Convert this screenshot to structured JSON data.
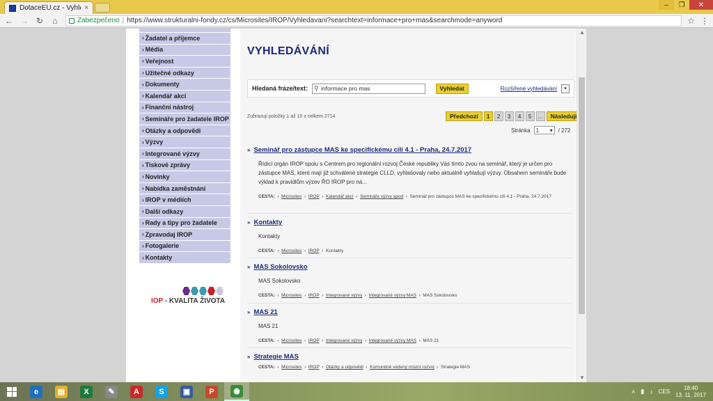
{
  "browser": {
    "tab_title": "DotaceEU.cz - Vyhledáv",
    "tab_close": "×",
    "secure_label": "Zabezpečeno",
    "url": "https://www.strukturalni-fondy.cz/cs/Microsites/IROP/Vyhledavani?searchtext=informace+pro+mas&searchmode=anyword",
    "icons": [
      "favicon-icon",
      "back-icon",
      "forward-icon",
      "reload-icon",
      "home-icon",
      "lock-icon",
      "star-icon",
      "menu-icon"
    ]
  },
  "sidebar": {
    "items": [
      "Žadatel a příjemce",
      "Média",
      "Veřejnost",
      "Užitečné odkazy",
      "Dokumenty",
      "Kalendář akcí",
      "Finanční nástroj",
      "Semináře pro žadatele IROP",
      "Otázky a odpovědi",
      "Výzvy",
      "Integrované výzvy",
      "Tiskové zprávy",
      "Novinky",
      "Nabídka zaměstnání",
      "IROP v médiích",
      "Další odkazy",
      "Rady a tipy pro žadatele",
      "Zpravodaj IROP",
      "Fotogalerie",
      "Kontakty"
    ],
    "logo": {
      "prefix": "IOP",
      "suffix": " - KVALITA ŽIVOTA",
      "hex_colors": [
        "#6a2a8c",
        "#3a9ab0",
        "#3a9ab0",
        "#c8202a",
        "#c8c8d8"
      ]
    }
  },
  "main": {
    "title": "VYHLEDÁVÁNÍ",
    "search": {
      "label": "Hledaná fráze/text:",
      "value": "informace pro mas",
      "button": "Vyhledat",
      "advanced": "Rozšířené vyhledávání"
    },
    "results_info": "Zobrazuji položky 1 až 10 z celkem 2714",
    "pager": {
      "prev": "Předchozí",
      "pages": [
        "1",
        "2",
        "3",
        "4",
        "5",
        "..."
      ],
      "next": "Následující",
      "page_label": "Stránka",
      "page_value": "1",
      "total": "/ 272"
    },
    "path_label": "CESTA:",
    "results": [
      {
        "title": "Seminář pro zástupce MAS ke specifickému cíli 4.1 - Praha, 24.7.2017",
        "desc": "Řídicí orgán IROP spolu s Centrem pro regionální rozvoj České republiky Vás tímto zvou na seminář, který je určen pro zástupce MAS, které mají již schválené strategie CLLD, vyhlašovaly nebo aktuálně vyhlašují výzvy. Obsahem semináře bude výklad k pravidlům výzev ŘO IROP pro ná...",
        "path": [
          "Microsites",
          "IROP",
          "Kalendář akcí",
          "Semináře výzvy apod"
        ],
        "path_end": "Seminář pro zástupce MAS ke specifickému cíli 4.1 - Praha, 24.7.2017"
      },
      {
        "title": "Kontakty",
        "desc": "Kontakty",
        "path": [
          "Microsites",
          "IROP"
        ],
        "path_end": "Kontakty"
      },
      {
        "title": "MAS Sokolovsko",
        "desc": "MAS Sokolovsko",
        "path": [
          "Microsites",
          "IROP",
          "Integrované výzvy",
          "Integrované výzvy MAS"
        ],
        "path_end": "MAS Sokolovsko"
      },
      {
        "title": "MAS 21",
        "desc": "MAS 21",
        "path": [
          "Microsites",
          "IROP",
          "Integrované výzvy",
          "Integrované výzvy MAS"
        ],
        "path_end": "MAS 21"
      },
      {
        "title": "Strategie MAS",
        "desc": "",
        "path": [
          "Microsites",
          "IROP",
          "Otázky a odpovědi",
          "Komunitně vedený místní rozvoj"
        ],
        "path_end": "Strategie MAS"
      }
    ]
  },
  "taskbar": {
    "apps": [
      {
        "name": "windows-explorer",
        "color": "#1d6fc0",
        "glyph": "e"
      },
      {
        "name": "file-explorer",
        "color": "#e0b030",
        "glyph": "▤"
      },
      {
        "name": "excel",
        "color": "#1e7a3c",
        "glyph": "X"
      },
      {
        "name": "paint",
        "color": "#888888",
        "glyph": "✎"
      },
      {
        "name": "acrobat",
        "color": "#c82a2a",
        "glyph": "A"
      },
      {
        "name": "skype",
        "color": "#1aa0e0",
        "glyph": "S"
      },
      {
        "name": "save",
        "color": "#3a5a9a",
        "glyph": "▣"
      },
      {
        "name": "powerpoint",
        "color": "#c8482a",
        "glyph": "P"
      },
      {
        "name": "chrome",
        "color": "#3a8a3a",
        "glyph": "◉"
      }
    ],
    "lang": "CES",
    "time": "18:40",
    "date": "13. 11. 2017"
  }
}
